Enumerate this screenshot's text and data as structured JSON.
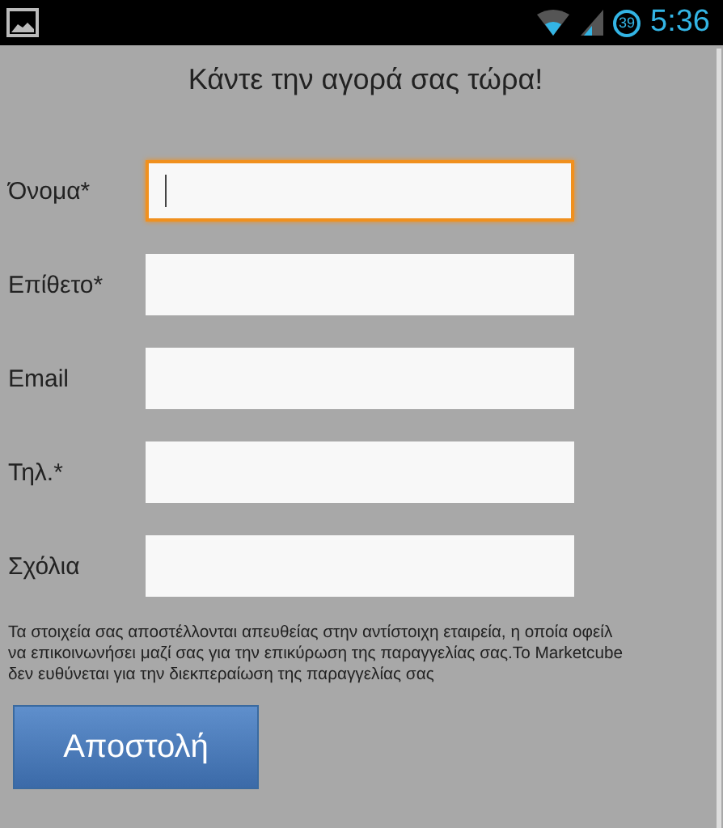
{
  "status_bar": {
    "battery_badge": "39",
    "time": "5:36"
  },
  "title": "Κάντε την αγορά σας τώρα!",
  "fields": [
    {
      "label": "Όνομα*",
      "focused": true
    },
    {
      "label": "Επίθετο*",
      "focused": false
    },
    {
      "label": "Email",
      "focused": false
    },
    {
      "label": "Τηλ.*",
      "focused": false
    },
    {
      "label": "Σχόλια",
      "focused": false
    }
  ],
  "notice": "Τα στοιχεία σας αποστέλλονται απευθείας στην αντίστοιχη εταιρεία, η οποία οφείλ\nνα επικοινωνήσει μαζί σας για την επικύρωση της παραγγελίας σας.Το Marketcube\nδεν ευθύνεται για την διεκπεραίωση της παραγγελίας σας",
  "submit_button": "Αποστολή"
}
